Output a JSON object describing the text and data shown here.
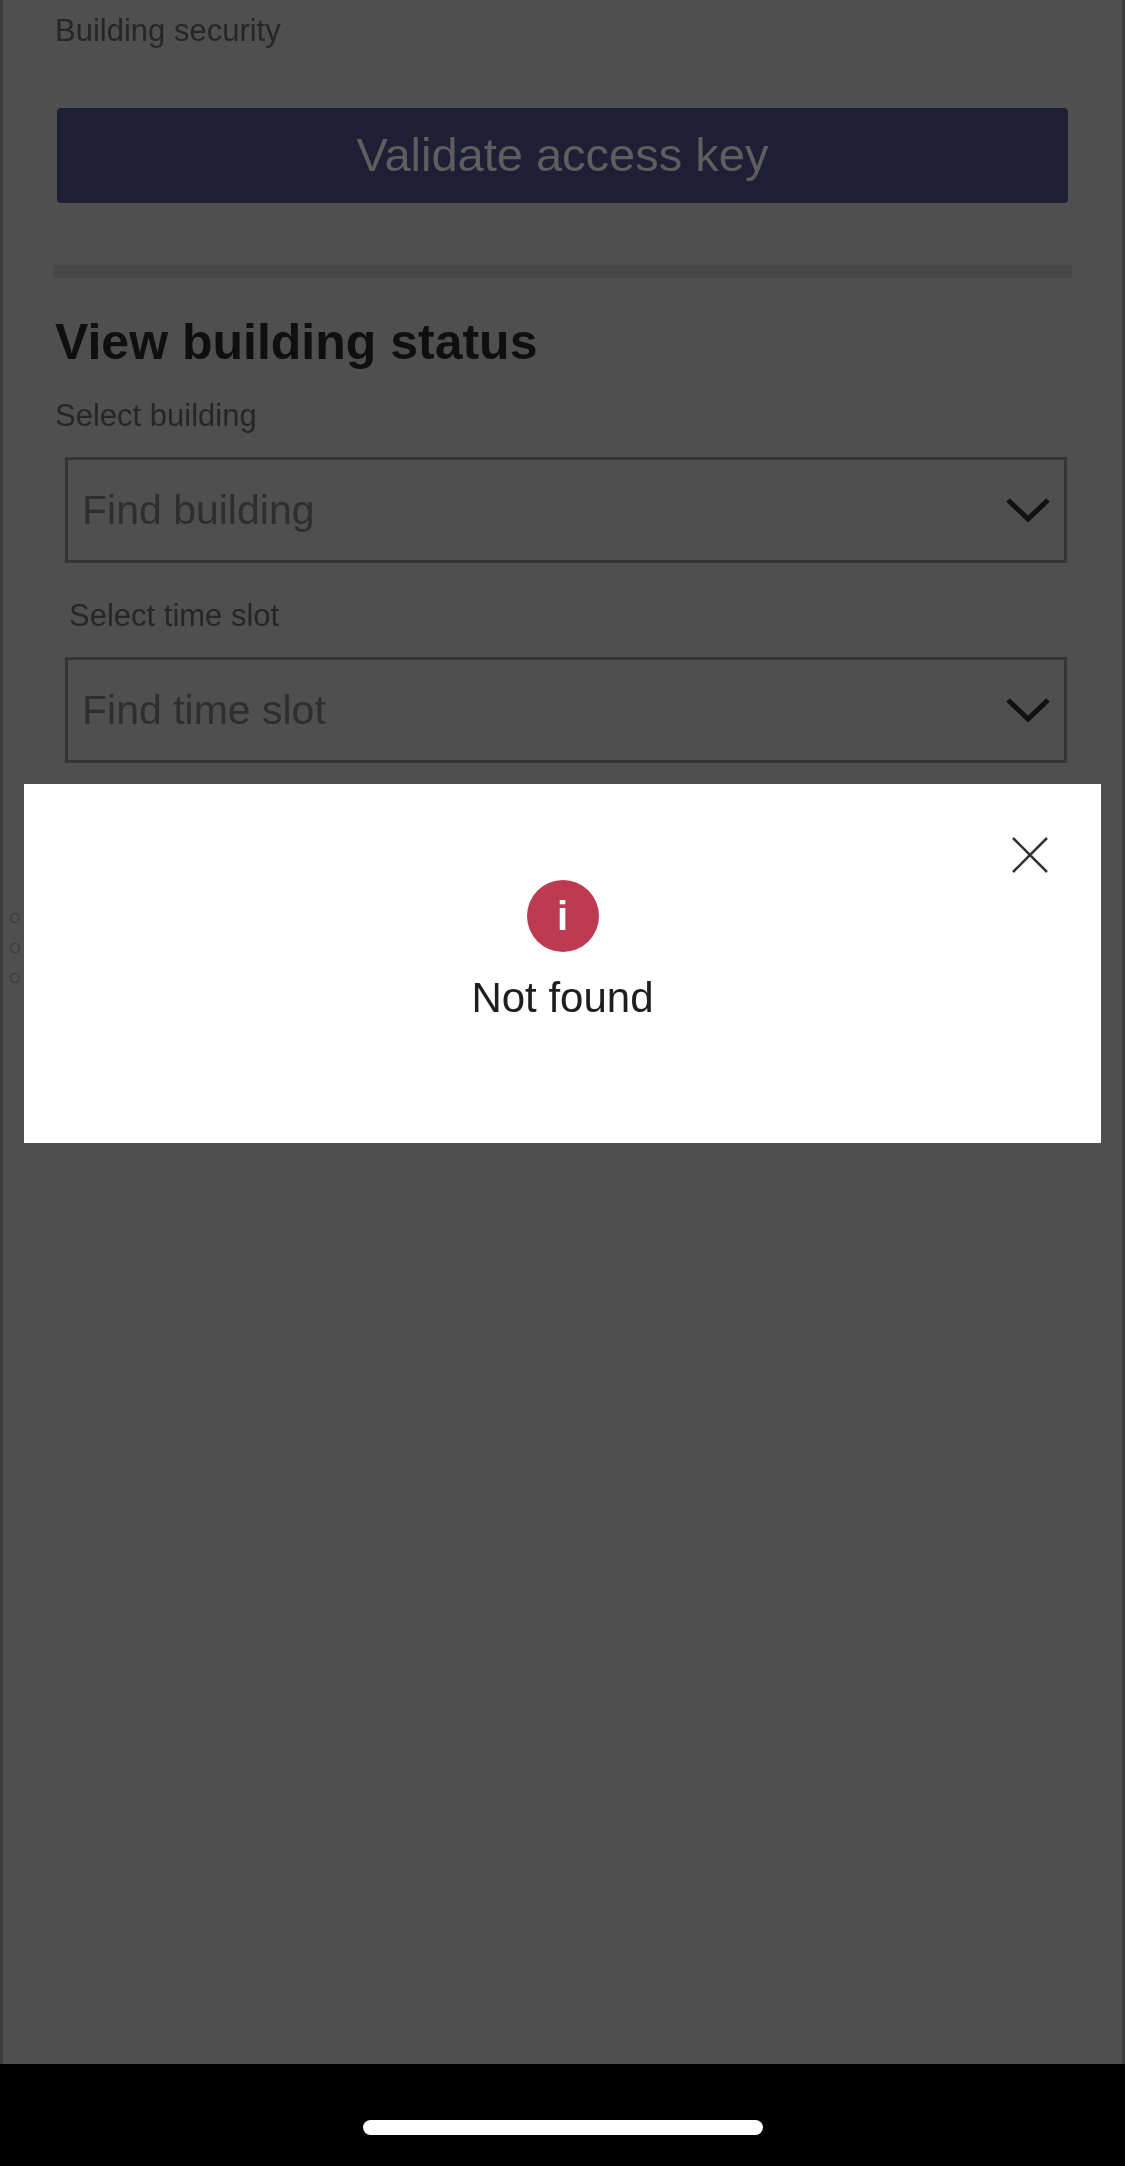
{
  "section_label": "Building security",
  "validate_button": {
    "label": "Validate access key",
    "disabled": true
  },
  "building_status": {
    "title": "View building status",
    "fields": [
      {
        "label": "Select building",
        "placeholder": "Find building"
      },
      {
        "label": "Select time slot",
        "placeholder": "Find time slot"
      }
    ]
  },
  "dialog": {
    "message": "Not found",
    "icon": "i"
  }
}
